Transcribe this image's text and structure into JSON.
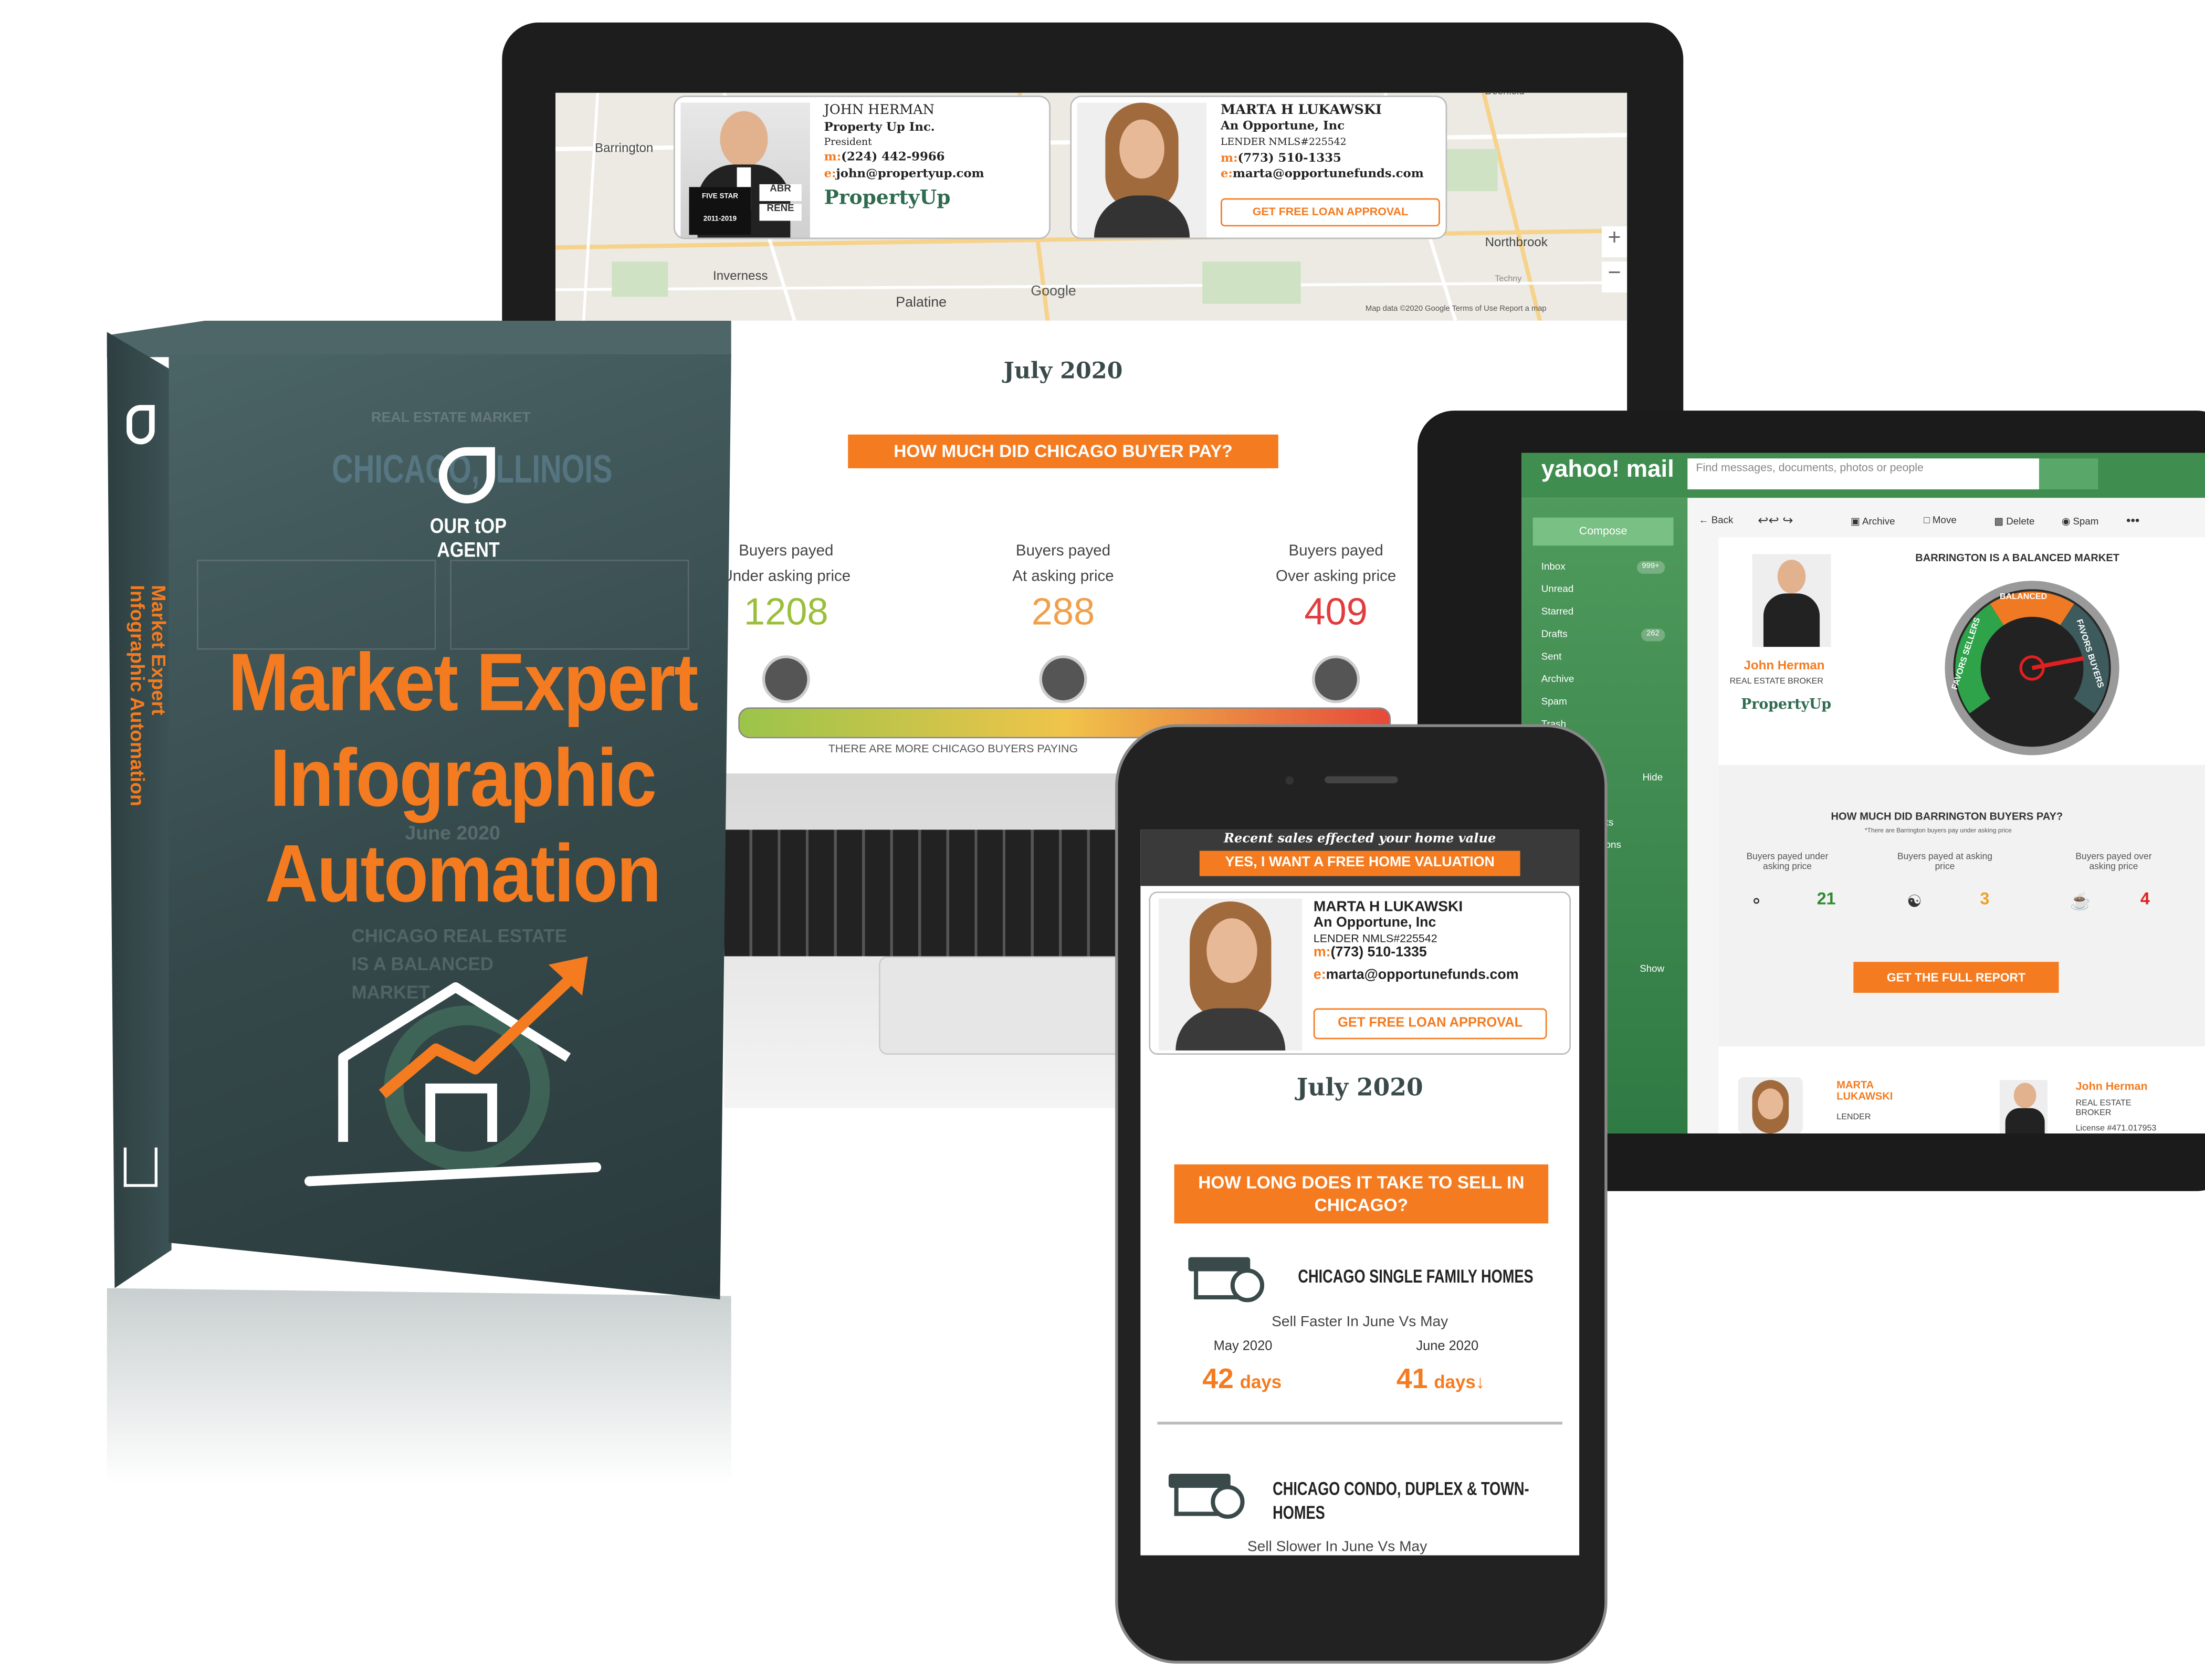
{
  "laptop": {
    "map": {
      "places": [
        "Barrington",
        "Inverness",
        "Palatine",
        "Northbrook",
        "Deerfield",
        "Techny"
      ],
      "zoom_in": "+",
      "zoom_out": "−",
      "attribution": "Map data ©2020 Google   Terms of Use   Report a map",
      "google": "Google"
    },
    "agent": {
      "name": "JOHN HERMAN",
      "company": "Property Up Inc.",
      "title": "President",
      "phone_prefix": "m:",
      "phone": "(224) 442-9966",
      "email_prefix": "e:",
      "email": "john@propertyup.com",
      "logo": "PropertyUp",
      "badge_top": "FIVE STAR",
      "badge_years": "2011-2019",
      "badge_abr": "ABR",
      "badge_rene": "RENE"
    },
    "lender": {
      "name": "MARTA H LUKAWSKI",
      "company": "An Opportune, Inc",
      "nmls": "LENDER NMLS#225542",
      "phone_prefix": "m:",
      "phone": "(773) 510-1335",
      "email_prefix": "e:",
      "email": "marta@opportunefunds.com",
      "cta": "GET FREE LOAN APPROVAL"
    },
    "month": "July 2020",
    "question": "HOW MUCH DID CHICAGO BUYER PAY?",
    "stats": [
      {
        "label1": "Buyers payed",
        "label2": "Under asking price",
        "value": "1208",
        "color": "#9bbf3a",
        "icon": "hand-money-icon"
      },
      {
        "label1": "Buyers payed",
        "label2": "At asking price",
        "value": "288",
        "color": "#f0a04b",
        "icon": "handshake-icon"
      },
      {
        "label1": "Buyers payed",
        "label2": "Over asking price",
        "value": "409",
        "color": "#e23c3c",
        "icon": "money-stack-icon"
      }
    ],
    "bar_caption": "THERE ARE MORE CHICAGO BUYERS PAYING"
  },
  "box": {
    "brand": "OUR tOP AGENT",
    "bg_header": "REAL ESTATE MARKET",
    "bg_city": "CHICAGO, ILLINOIS",
    "bg_month": "June 2020",
    "bg_market": "CHICAGO REAL ESTATE IS A BALANCED MARKET",
    "title_line1": "Market Expert",
    "title_line2": "Infographic",
    "title_line3": "Automation",
    "spine_line1": "Market Expert",
    "spine_line2": "Infographic Automation",
    "accent": "#f47b20"
  },
  "tablet": {
    "logo": "yahoo! mail",
    "search_placeholder": "Find messages, documents, photos or people",
    "compose": "Compose",
    "folders": [
      {
        "label": "Inbox",
        "count": "999+"
      },
      {
        "label": "Unread",
        "count": ""
      },
      {
        "label": "Starred",
        "count": ""
      },
      {
        "label": "Drafts",
        "count": "262"
      },
      {
        "label": "Sent",
        "count": ""
      },
      {
        "label": "Archive",
        "count": ""
      },
      {
        "label": "Spam",
        "count": ""
      },
      {
        "label": "Trash",
        "count": ""
      }
    ],
    "hide": "Hide",
    "show": "Show",
    "partial": [
      "nts",
      "tions",
      "s"
    ],
    "toolbar": [
      "Back",
      "Archive",
      "Move",
      "Delete",
      "Spam"
    ],
    "market_title": "BARRINGTON IS A BALANCED MARKET",
    "gauge_labels": [
      "FAVORS SELLERS",
      "BALANCED",
      "FAVORS BUYERS"
    ],
    "agent_name": "John Herman",
    "agent_title": "REAL ESTATE BROKER",
    "agent_logo": "PropertyUp",
    "question": "HOW MUCH DID BARRINGTON BUYERS PAY?",
    "note": "*There are Barrington buyers pay under asking price",
    "stats": [
      {
        "label": "Buyers payed under asking price",
        "value": "21",
        "color": "#2e8b2e"
      },
      {
        "label": "Buyers payed at asking price",
        "value": "3",
        "color": "#f0a020"
      },
      {
        "label": "Buyers payed over asking price",
        "value": "4",
        "color": "#e02020"
      }
    ],
    "cta": "GET THE FULL REPORT",
    "footer_lender_name": "MARTA LUKAWSKI",
    "footer_lender_title": "LENDER",
    "footer_agent_name": "John Herman",
    "footer_agent_title": "REAL ESTATE BROKER",
    "footer_agent_license": "License #471.017953"
  },
  "phone": {
    "banner": "Recent sales effected your home value",
    "valuation_cta": "YES, I WANT A FREE HOME VALUATION",
    "lender": {
      "name": "MARTA H LUKAWSKI",
      "company": "An Opportune, Inc",
      "nmls": "LENDER NMLS#225542",
      "phone_prefix": "m:",
      "phone": "(773) 510-1335",
      "email_prefix": "e:",
      "email": "marta@opportunefunds.com",
      "cta": "GET FREE LOAN APPROVAL"
    },
    "month": "July 2020",
    "question": "HOW LONG DOES IT TAKE TO SELL IN CHICAGO?",
    "section1": {
      "title": "CHICAGO SINGLE FAMILY HOMES",
      "subtitle": "Sell Faster In June Vs May",
      "col1_label": "May 2020",
      "col1_value": "42",
      "col2_label": "June 2020",
      "col2_value": "41",
      "unit": "days",
      "trend_icon": "↓"
    },
    "section2": {
      "title": "CHICAGO CONDO, DUPLEX & TOWN-HOMES",
      "subtitle": "Sell Slower In June Vs May"
    }
  }
}
